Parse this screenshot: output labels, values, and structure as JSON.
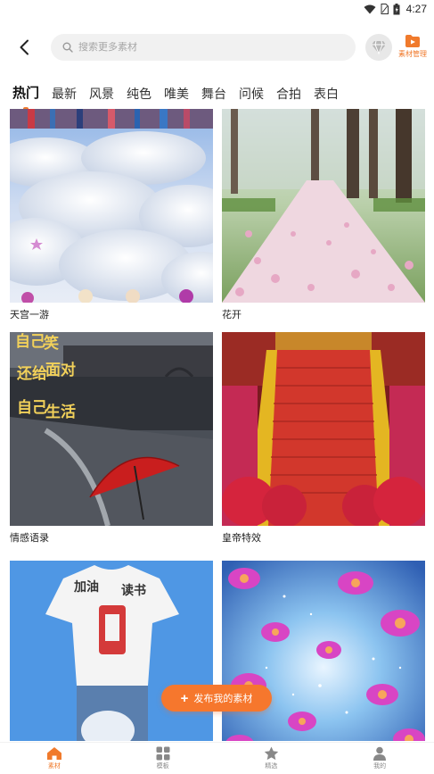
{
  "status_bar": {
    "time": "4:27"
  },
  "header": {
    "search_placeholder": "搜索更多素材",
    "manage_label": "素材管理"
  },
  "tabs": [
    {
      "label": "热门",
      "active": true
    },
    {
      "label": "最新",
      "active": false
    },
    {
      "label": "风景",
      "active": false
    },
    {
      "label": "纯色",
      "active": false
    },
    {
      "label": "唯美",
      "active": false
    },
    {
      "label": "舞台",
      "active": false
    },
    {
      "label": "问候",
      "active": false
    },
    {
      "label": "合拍",
      "active": false
    },
    {
      "label": "表白",
      "active": false
    }
  ],
  "items": [
    {
      "title": "天宫一游",
      "image": "clouds-sky"
    },
    {
      "title": "花开",
      "image": "blossom-path"
    },
    {
      "title": "情感语录",
      "image": "rain-umbrella",
      "overlay_text": [
        "自己",
        "还给",
        "自己",
        "笑",
        "面对",
        "生活"
      ]
    },
    {
      "title": "皇帝特效",
      "image": "palace-stairs"
    },
    {
      "title": "",
      "image": "child-tshirt",
      "overlay_text": [
        "加油",
        "读书"
      ]
    },
    {
      "title": "",
      "image": "flower-galaxy"
    }
  ],
  "publish_button": {
    "label": "发布我的素材"
  },
  "bottom_nav": [
    {
      "label": "素材",
      "icon": "home-icon",
      "active": true
    },
    {
      "label": "模板",
      "icon": "grid-icon",
      "active": false
    },
    {
      "label": "精选",
      "icon": "star-icon",
      "active": false
    },
    {
      "label": "我的",
      "icon": "user-icon",
      "active": false
    }
  ],
  "colors": {
    "accent": "#f07a2c",
    "search_bg": "#f1f1f1"
  }
}
